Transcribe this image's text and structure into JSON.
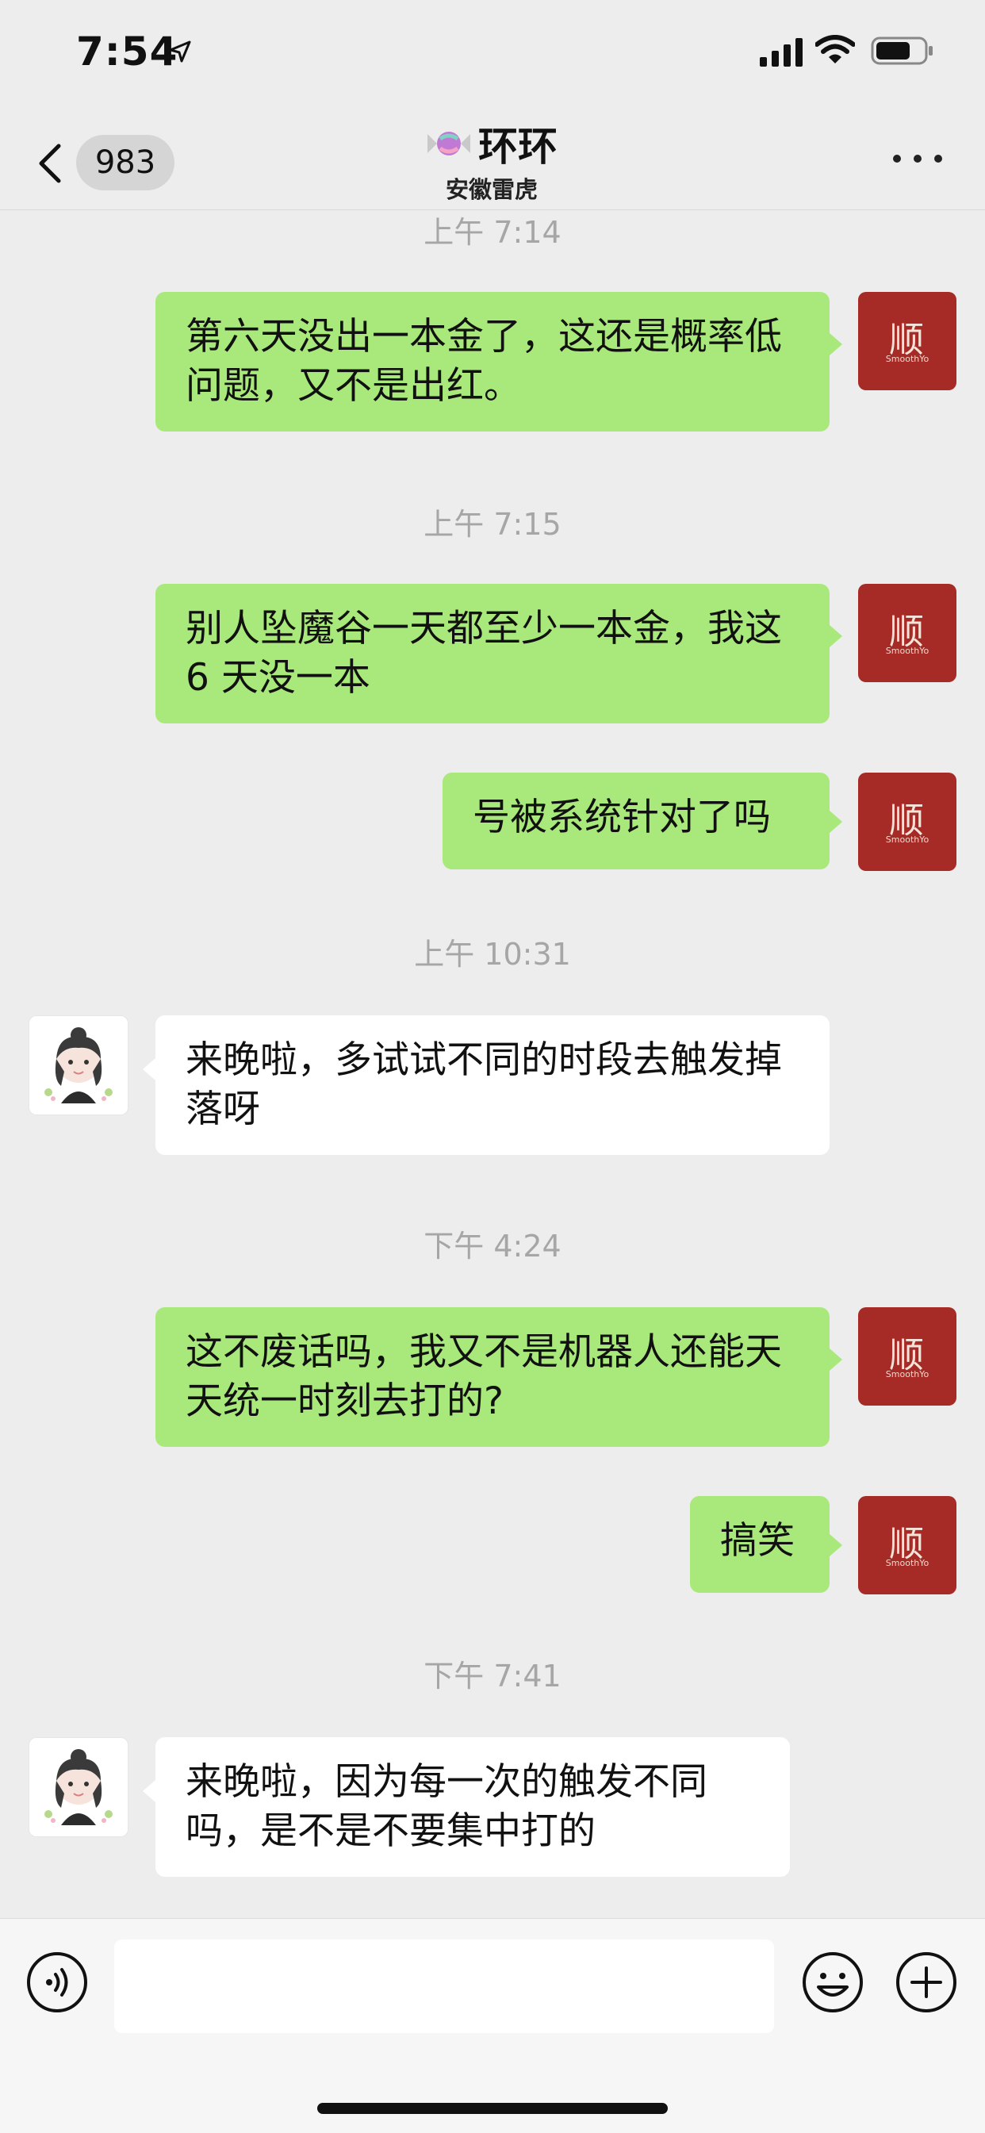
{
  "status_bar": {
    "time": "7:54"
  },
  "nav": {
    "unread_count": "983",
    "title": "环环",
    "subtitle": "安徽雷虎"
  },
  "avatars": {
    "me_text": "顺",
    "me_small": "SmoothYo"
  },
  "messages": [
    {
      "type": "timestamp",
      "text": "上午 7:14"
    },
    {
      "type": "sent",
      "text": "第六天没出一本金了，这还是概率低问题，又不是出红。"
    },
    {
      "type": "timestamp",
      "text": "上午 7:15"
    },
    {
      "type": "sent",
      "text": "别人坠魔谷一天都至少一本金，我这 6 天没一本"
    },
    {
      "type": "sent",
      "text": "号被系统针对了吗"
    },
    {
      "type": "timestamp",
      "text": "上午 10:31"
    },
    {
      "type": "received",
      "text": "来晚啦，多试试不同的时段去触发掉落呀"
    },
    {
      "type": "timestamp",
      "text": "下午 4:24"
    },
    {
      "type": "sent",
      "text": "这不废话吗，我又不是机器人还能天天统一时刻去打的?"
    },
    {
      "type": "sent",
      "text": "搞笑"
    },
    {
      "type": "timestamp",
      "text": "下午 7:41"
    },
    {
      "type": "received",
      "text": "来晚啦，因为每一次的触发不同吗，是不是不要集中打的"
    }
  ],
  "input": {
    "value": "",
    "placeholder": ""
  }
}
